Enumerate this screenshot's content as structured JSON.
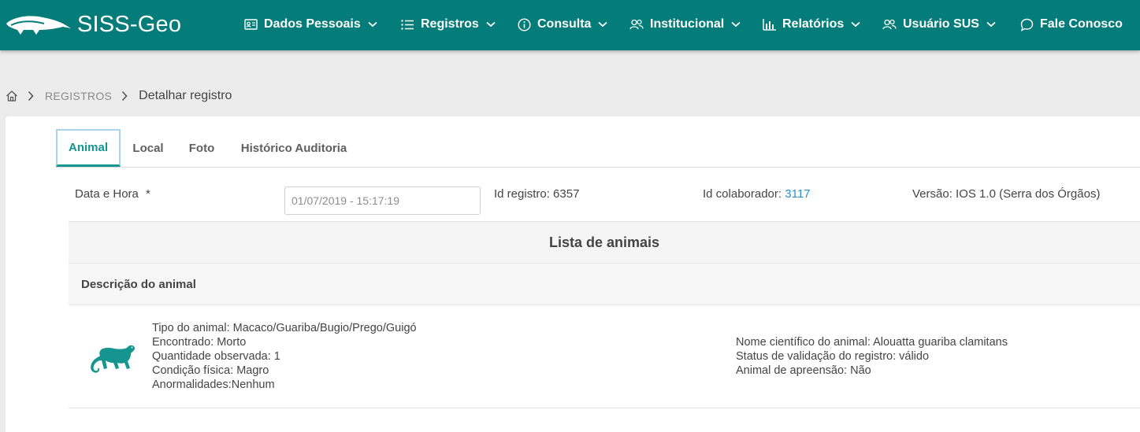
{
  "app": {
    "logo_text": "SISS-Geo"
  },
  "nav": {
    "items": [
      {
        "label": "Dados Pessoais",
        "icon": "id-card-icon"
      },
      {
        "label": "Registros",
        "icon": "list-icon"
      },
      {
        "label": "Consulta",
        "icon": "info-icon"
      },
      {
        "label": "Institucional",
        "icon": "users-icon"
      },
      {
        "label": "Relatórios",
        "icon": "bar-chart-icon"
      },
      {
        "label": "Usuário SUS",
        "icon": "users-icon"
      },
      {
        "label": "Fale Conosco",
        "icon": "chat-icon"
      }
    ]
  },
  "breadcrumb": {
    "level1": "REGISTROS",
    "level2": "Detalhar registro"
  },
  "tabs": [
    {
      "label": "Animal",
      "active": true
    },
    {
      "label": "Local",
      "active": false
    },
    {
      "label": "Foto",
      "active": false
    },
    {
      "label": "Histórico Auditoria",
      "active": false
    }
  ],
  "record": {
    "date_label": "Data e Hora",
    "required_mark": "*",
    "date_value": "01/07/2019 - 15:17:19",
    "id_registro_label": "Id registro:",
    "id_registro": "6357",
    "id_colaborador_label": "Id colaborador:",
    "id_colaborador": "3117",
    "versao_label": "Versão:",
    "versao": "IOS 1.0 (Serra dos Órgãos)"
  },
  "list": {
    "title": "Lista de animais",
    "description_header": "Descrição do animal"
  },
  "animal": {
    "icon": "monkey-icon",
    "left": [
      "Tipo do animal: Macaco/Guariba/Bugio/Prego/Guigó",
      "Encontrado: Morto",
      "Quantidade observada: 1",
      "Condição física: Magro",
      "Anormalidades:Nenhum"
    ],
    "right": [
      "Nome científico do animal: Alouatta guariba clamitans",
      "Status de validação do registro: válido",
      "Animal de apreensão: Não"
    ]
  },
  "colors": {
    "primary": "#047c79",
    "accent": "#14958f",
    "link": "#2a8fcf"
  }
}
